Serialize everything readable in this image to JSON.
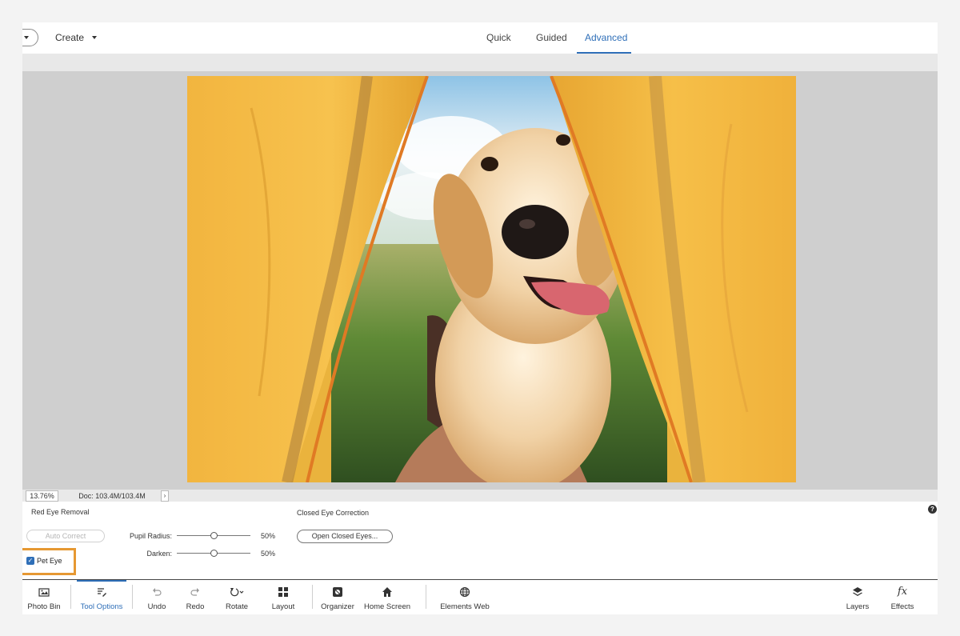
{
  "topbar": {
    "create_label": "Create",
    "modes": [
      "Quick",
      "Guided",
      "Advanced"
    ],
    "active_mode": "Advanced"
  },
  "status": {
    "zoom": "13.76%",
    "doc": "Doc: 103.4M/103.4M",
    "arrow": "›"
  },
  "tool_options": {
    "red_eye_title": "Red Eye Removal",
    "auto_correct": "Auto Correct",
    "pupil_radius_label": "Pupil Radius:",
    "pupil_radius_value": "50%",
    "darken_label": "Darken:",
    "darken_value": "50%",
    "pet_eye_label": "Pet Eye",
    "pet_eye_checked": true,
    "closed_eye_title": "Closed Eye Correction",
    "open_closed_eyes": "Open Closed Eyes...",
    "help": "?"
  },
  "bottombar": {
    "items": [
      {
        "label": "Photo Bin",
        "icon": "photo-bin-icon"
      },
      {
        "label": "Tool Options",
        "icon": "tool-options-icon"
      },
      {
        "label": "Undo",
        "icon": "undo-icon"
      },
      {
        "label": "Redo",
        "icon": "redo-icon"
      },
      {
        "label": "Rotate",
        "icon": "rotate-icon"
      },
      {
        "label": "Layout",
        "icon": "layout-icon"
      },
      {
        "label": "Organizer",
        "icon": "organizer-icon"
      },
      {
        "label": "Home Screen",
        "icon": "home-icon"
      },
      {
        "label": "Elements Web",
        "icon": "globe-icon"
      },
      {
        "label": "Layers",
        "icon": "layers-icon"
      },
      {
        "label": "Effects",
        "icon": "fx-icon"
      }
    ],
    "active": "Tool Options"
  },
  "colors": {
    "accent": "#2f6fb8",
    "highlight": "#e69832",
    "canvas_bg": "#cfcfcf"
  }
}
